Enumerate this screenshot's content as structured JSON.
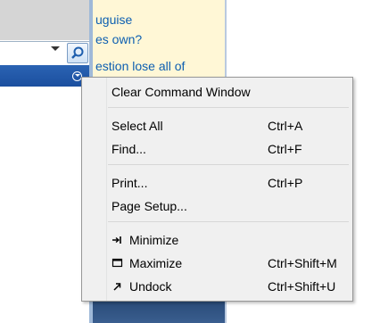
{
  "help_panel": {
    "lines": [
      "uguise",
      "es own?",
      "estion lose all of"
    ]
  },
  "context_menu": {
    "items": [
      {
        "label": "Clear Command Window",
        "shortcut": ""
      },
      {
        "label": "Select All",
        "shortcut": "Ctrl+A"
      },
      {
        "label": "Find...",
        "shortcut": "Ctrl+F"
      },
      {
        "label": "Print...",
        "shortcut": "Ctrl+P"
      },
      {
        "label": "Page Setup...",
        "shortcut": ""
      },
      {
        "label": "Minimize",
        "shortcut": "",
        "icon": "minimize-icon"
      },
      {
        "label": "Maximize",
        "shortcut": "Ctrl+Shift+M",
        "icon": "maximize-icon"
      },
      {
        "label": "Undock",
        "shortcut": "Ctrl+Shift+U",
        "icon": "undock-icon"
      }
    ]
  },
  "colors": {
    "menu_bg": "#f0f0f0",
    "help_link": "#0d5fb1",
    "help_bg": "#fff7d6",
    "title_bar": "#1b4f9f"
  }
}
